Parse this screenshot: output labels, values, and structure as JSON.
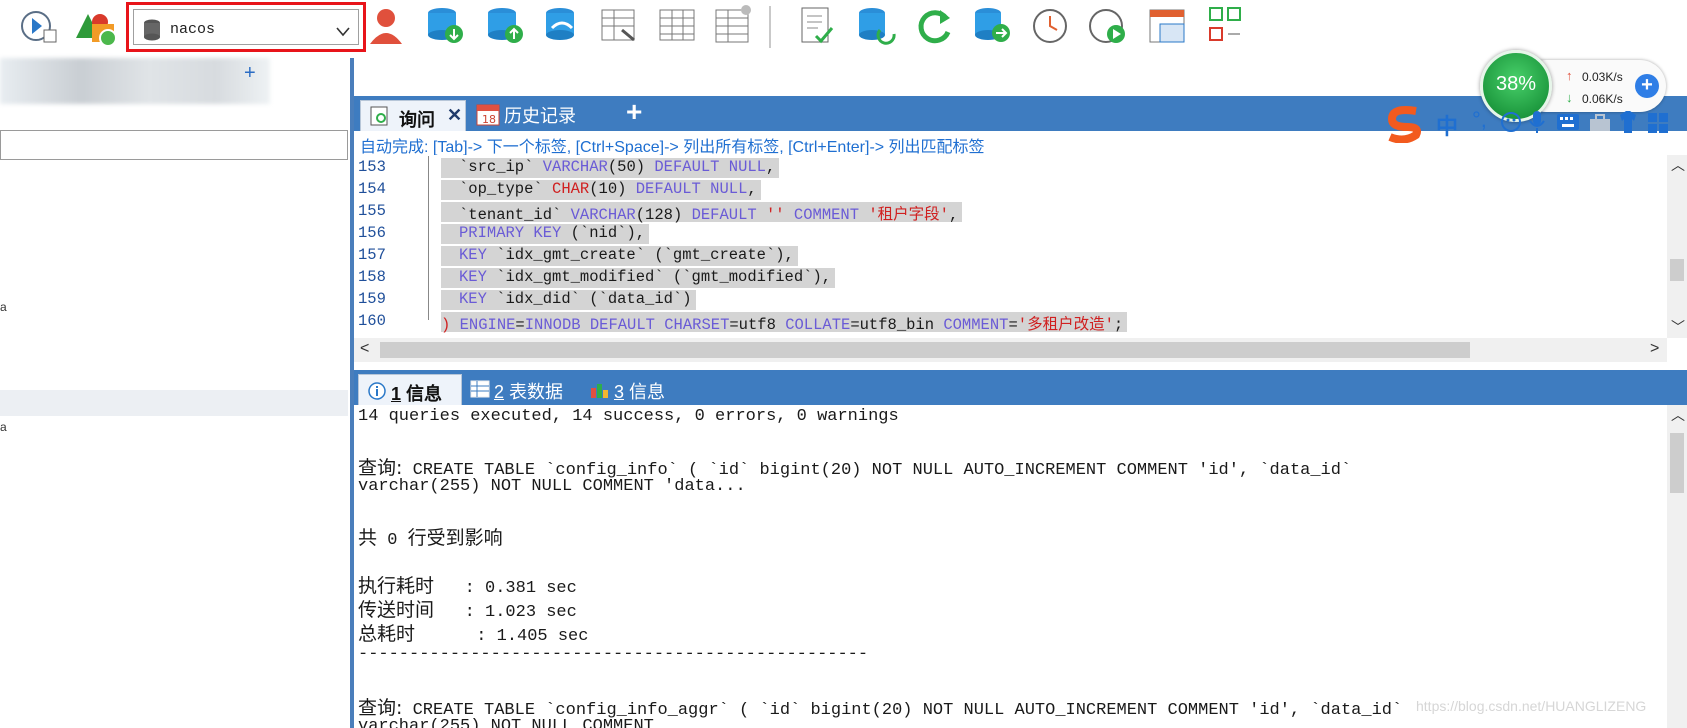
{
  "toolbar": {
    "database_selector": {
      "value": "nacos"
    },
    "icons": [
      "query-exec-icon",
      "schema-sync-icon",
      "user-manager-icon",
      "backup-db-icon",
      "restore-db-icon",
      "copy-db-icon",
      "table-designer-icon",
      "table-grid-icon",
      "table-manager-icon",
      "report-icon",
      "db-sync-icon",
      "refresh-icon",
      "export-icon",
      "scheduler-icon",
      "job-run-icon",
      "layout-icon",
      "schema-compare-icon"
    ]
  },
  "left_panel": {
    "search": {
      "value": ""
    },
    "items": [
      "a",
      "a"
    ]
  },
  "query_tabs": {
    "tabs": [
      {
        "label": "询问"
      },
      {
        "label": "历史记录"
      }
    ],
    "add_label": "+"
  },
  "autocomplete_hint": "自动完成: [Tab]-> 下一个标签, [Ctrl+Space]-> 列出所有标签, [Ctrl+Enter]-> 列出匹配标签",
  "editor": {
    "lines": [
      {
        "no": "153",
        "segs": [
          [
            "id",
            "`src_ip` "
          ],
          [
            "kw",
            "VARCHAR"
          ],
          [
            "id",
            "(50) "
          ],
          [
            "kw",
            "DEFAULT NULL"
          ],
          [
            "id",
            ","
          ]
        ]
      },
      {
        "no": "154",
        "segs": [
          [
            "id",
            "`op_type` "
          ],
          [
            "str",
            "CHAR"
          ],
          [
            "id",
            "(10) "
          ],
          [
            "kw",
            "DEFAULT NULL"
          ],
          [
            "id",
            ","
          ]
        ]
      },
      {
        "no": "155",
        "segs": [
          [
            "id",
            "`tenant_id` "
          ],
          [
            "kw",
            "VARCHAR"
          ],
          [
            "id",
            "(128) "
          ],
          [
            "kw",
            "DEFAULT"
          ],
          [
            "id",
            " "
          ],
          [
            "str",
            "''"
          ],
          [
            "id",
            " "
          ],
          [
            "kw",
            "COMMENT"
          ],
          [
            "id",
            " "
          ],
          [
            "str",
            "'租户字段'"
          ],
          [
            "id",
            ","
          ]
        ]
      },
      {
        "no": "156",
        "segs": [
          [
            "kw",
            "PRIMARY KEY"
          ],
          [
            "id",
            " (`nid`),"
          ]
        ]
      },
      {
        "no": "157",
        "segs": [
          [
            "kw",
            "KEY"
          ],
          [
            "id",
            " `idx_gmt_create` (`gmt_create`),"
          ]
        ]
      },
      {
        "no": "158",
        "segs": [
          [
            "kw",
            "KEY"
          ],
          [
            "id",
            " `idx_gmt_modified` (`gmt_modified`),"
          ]
        ]
      },
      {
        "no": "159",
        "segs": [
          [
            "kw",
            "KEY"
          ],
          [
            "id",
            " `idx_did` (`data_id`)"
          ]
        ]
      },
      {
        "no": "160",
        "segs": [
          [
            "str",
            ") "
          ],
          [
            "kw",
            "ENGINE"
          ],
          [
            "id",
            "="
          ],
          [
            "kw",
            "INNODB DEFAULT CHARSET"
          ],
          [
            "id",
            "=utf8 "
          ],
          [
            "kw",
            "COLLATE"
          ],
          [
            "id",
            "=utf8_bin "
          ],
          [
            "kw",
            "COMMENT"
          ],
          [
            "id",
            "="
          ],
          [
            "str",
            "'多租户改造'"
          ],
          [
            "id",
            ";"
          ]
        ]
      }
    ]
  },
  "result_tabs": {
    "tabs": [
      {
        "num": "1",
        "label": "信息"
      },
      {
        "num": "2",
        "label": "表数据"
      },
      {
        "num": "3",
        "label": "信息"
      }
    ]
  },
  "messages": {
    "summary": "14 queries executed, 14 success, 0 errors, 0 warnings",
    "query1_prefix": "查询:",
    "query1_text": " CREATE TABLE `config_info` ( `id` bigint(20) NOT NULL AUTO_INCREMENT COMMENT 'id', `data_id`",
    "query1_cont": "varchar(255) NOT NULL COMMENT 'data...",
    "affected_a": "共",
    "affected_b": " 0 ",
    "affected_c": "行受到影响",
    "exec_label": "执行耗时",
    "exec_value": "   : 0.381 sec",
    "transfer_label": "传送时间",
    "transfer_value": "   : 1.023 sec",
    "total_label": "总耗时",
    "total_value": "      : 1.405 sec",
    "divider": "--------------------------------------------------",
    "query2_prefix": "查询:",
    "query2_text": " CREATE TABLE `config_info_aggr` ( `id` bigint(20) NOT NULL AUTO_INCREMENT COMMENT 'id', `data_id`",
    "query2_cont": "varchar(255) NOT NULL COMMENT"
  },
  "net_widget": {
    "percent": "38%",
    "upload": "0.03K/s",
    "download": "0.06K/s"
  },
  "ime": {
    "lang": "中"
  },
  "watermark": "https://blog.csdn.net/HUANGLIZENG"
}
